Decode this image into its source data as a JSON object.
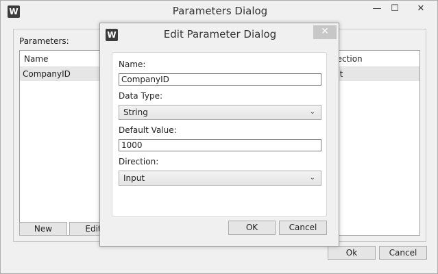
{
  "main_window": {
    "logo_letter": "W",
    "title": "Parameters Dialog",
    "caption_buttons": {
      "minimize": "—",
      "maximize": "☐",
      "close": "✕"
    },
    "parameters_label": "Parameters:",
    "columns": [
      "Name",
      "rection"
    ],
    "rows": [
      {
        "name": "CompanyID",
        "direction": "ut"
      }
    ],
    "buttons": {
      "new": "New",
      "edit": "Edit",
      "ok": "Ok",
      "cancel": "Cancel"
    }
  },
  "edit_dialog": {
    "logo_letter": "W",
    "title": "Edit Parameter Dialog",
    "close": "✕",
    "fields": {
      "name_label": "Name:",
      "name_value": "CompanyID",
      "data_type_label": "Data Type:",
      "data_type_value": "String",
      "default_value_label": "Default Value:",
      "default_value_value": "1000",
      "direction_label": "Direction:",
      "direction_value": "Input"
    },
    "buttons": {
      "ok": "OK",
      "cancel": "Cancel"
    }
  },
  "colors": {
    "window_bg": "#f0f0f0",
    "panel_bg": "#ffffff",
    "selected_row": "#e6e6e6",
    "close_button": "#c7c7c7"
  }
}
